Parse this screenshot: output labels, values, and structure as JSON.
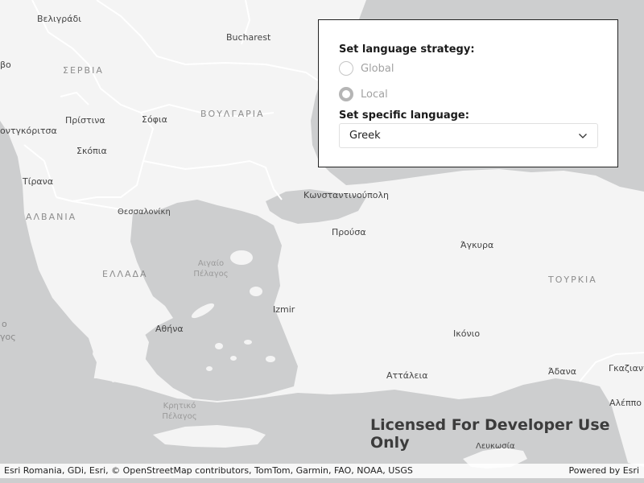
{
  "map": {
    "labels": {
      "belgrade": "Βελιγράδι",
      "bucharest": "Bucharest",
      "serbia": "ΣΕΡΒΙΑ",
      "pristina": "Πρίστινα",
      "sofia": "Σόφια",
      "bulgaria": "ΒΟΥΛΓΑΡΙΑ",
      "podgorica": "οντγκόριτσα",
      "skopje": "Σκόπια",
      "tirana": "Τίρανα",
      "albania": "ΑΛΒΑΝΙΑ",
      "thessaloniki": "Θεσσαλονίκη",
      "constantinople": "Κωνσταντινούπολη",
      "bursa": "Προύσα",
      "ankara": "Άγκυρα",
      "aegean_sea_line1": "Αιγαίο",
      "aegean_sea_line2": "Πέλαγος",
      "greece": "ΕΛΛΑΔΑ",
      "turkey": "ΤΟΥΡΚΙΑ",
      "izmir": "Izmir",
      "athens": "Αθήνα",
      "konya": "Ικόνιο",
      "antalya": "Αττάλεια",
      "adana": "Άδανα",
      "gaziantep": "Γκαζιαντ",
      "aleppo": "Αλέππο",
      "cretan_sea_line1": "Κρητικό",
      "cretan_sea_line2": "Πέλαγος",
      "nicosia": "Λευκωσία",
      "edge_bo": "βο",
      "edge_o": "ο",
      "edge_gos": "γος"
    },
    "colors": {
      "land": "#f4f4f4",
      "water": "#cdcecf",
      "border": "#ffffff"
    }
  },
  "panel": {
    "strategy_label": "Set language strategy:",
    "options": [
      {
        "label": "Global",
        "checked": false
      },
      {
        "label": "Local",
        "checked": true
      }
    ],
    "language_label": "Set specific language:",
    "language_value": "Greek"
  },
  "watermark": "Licensed For Developer Use Only",
  "attribution": {
    "left": "Esri Romania, GDi, Esri, © OpenStreetMap contributors, TomTom, Garmin, FAO, NOAA, USGS",
    "right": "Powered by Esri"
  }
}
